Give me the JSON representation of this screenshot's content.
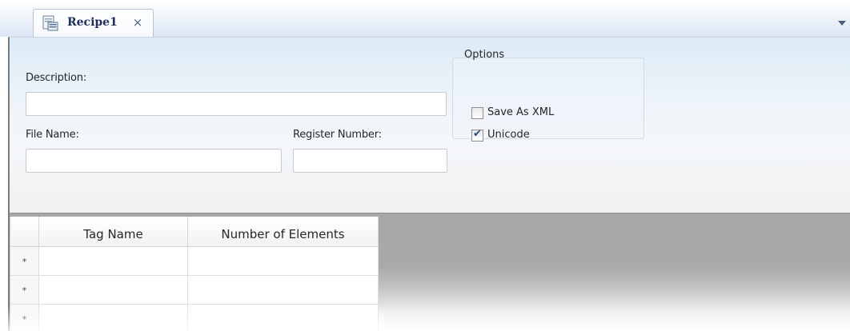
{
  "tab": {
    "label": "Recipe1",
    "close_glyph": "×",
    "icon": "recipe-document-icon"
  },
  "form": {
    "description_label": "Description:",
    "description_value": "",
    "file_name_label": "File Name:",
    "file_name_value": "",
    "register_number_label": "Register Number:",
    "register_number_value": ""
  },
  "options": {
    "title": "Options",
    "save_as_xml": {
      "label": "Save As XML",
      "checked": false
    },
    "unicode": {
      "label": "Unicode",
      "checked": true
    }
  },
  "grid": {
    "columns": [
      "Tag Name",
      "Number of Elements"
    ],
    "row_marker": "*",
    "rows": [
      {
        "marker": "*",
        "tag_name": "",
        "number_of_elements": ""
      },
      {
        "marker": "*",
        "tag_name": "",
        "number_of_elements": ""
      },
      {
        "marker": "*",
        "tag_name": "",
        "number_of_elements": ""
      }
    ]
  },
  "colors": {
    "tab_text": "#1f2d5a",
    "panel_top": "#dcebf7",
    "grid_background": "#a8a8a8",
    "checkbox_tick": "#2b4a80"
  }
}
